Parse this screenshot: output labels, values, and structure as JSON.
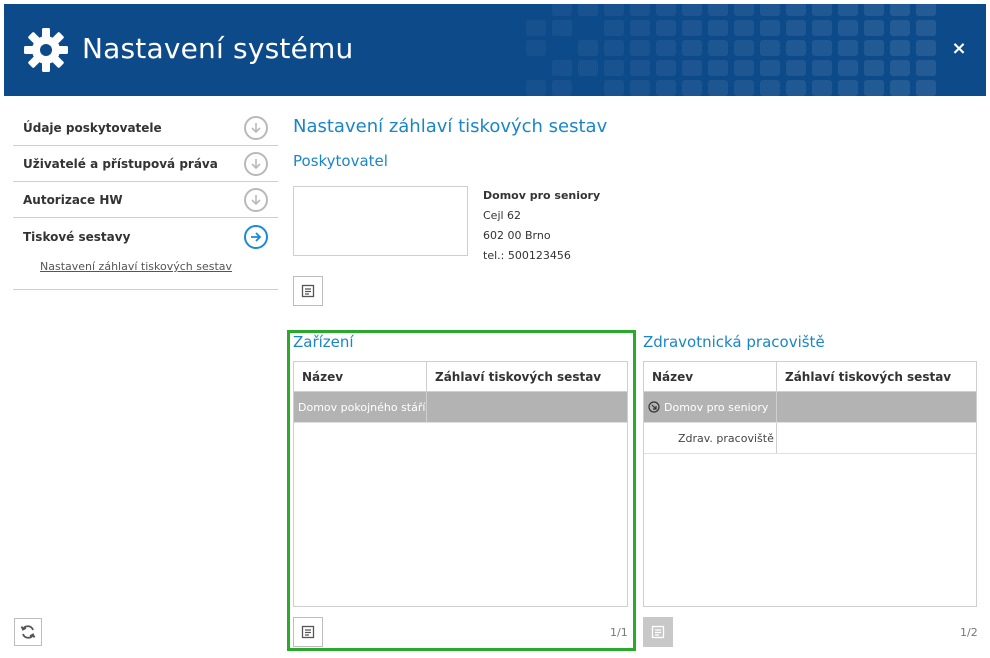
{
  "app": {
    "title": "Nastavení systému",
    "close_glyph": "×",
    "accent": "#0d4a8a",
    "link_color": "#1a86c8",
    "highlight_color": "#2aaa2a"
  },
  "sidebar": {
    "items": [
      {
        "label": "Údaje poskytovatele",
        "icon": "arrow-down-circle-icon"
      },
      {
        "label": "Uživatelé a přístupová práva",
        "icon": "arrow-down-circle-icon"
      },
      {
        "label": "Autorizace HW",
        "icon": "arrow-down-circle-icon"
      },
      {
        "label": "Tiskové sestavy",
        "icon": "arrow-right-circle-icon"
      }
    ],
    "sub_item": "Nastavení záhlaví tiskových sestav",
    "refresh_icon": "refresh-icon"
  },
  "main": {
    "title": "Nastavení záhlaví tiskových sestav",
    "provider_section": "Poskytovatel",
    "provider": {
      "name": "Domov pro seniory",
      "street": "Cejl 62",
      "city": "602 00 Brno",
      "phone": "tel.: 500123456"
    },
    "edit_icon": "edit-document-icon"
  },
  "facilities": {
    "title": "Zařízení",
    "columns": [
      "Název",
      "Záhlaví tiskových sestav"
    ],
    "rows": [
      {
        "name": "Domov pokojného stáří",
        "header": ""
      }
    ],
    "pager": "1/1"
  },
  "workplaces": {
    "title": "Zdravotnická pracoviště",
    "columns": [
      "Název",
      "Záhlaví tiskových sestav"
    ],
    "rows": [
      {
        "name": "Domov pro seniory",
        "header": "",
        "expander_icon": "collapse-arrow-icon"
      },
      {
        "name": "Zdrav. pracoviště",
        "header": ""
      }
    ],
    "pager": "1/2"
  }
}
